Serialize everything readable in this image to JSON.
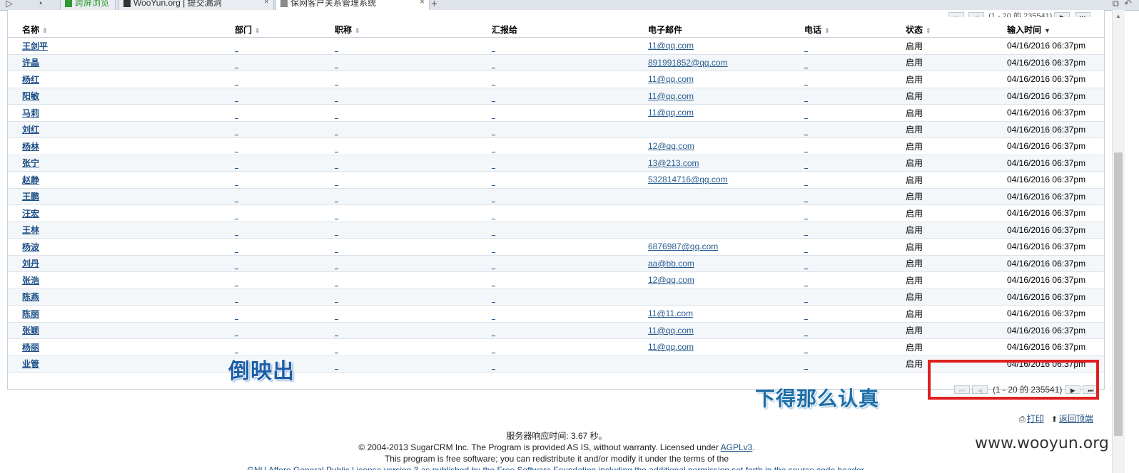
{
  "browser": {
    "tabs": [
      {
        "label": "跨屏浏览"
      },
      {
        "label": "WooYun.org | 提交漏洞"
      },
      {
        "label": "保网客户关系管理系统"
      }
    ],
    "new_tab": "+"
  },
  "columns": [
    {
      "label": "名称",
      "sort": "⇕"
    },
    {
      "label": "部门",
      "sort": "⇕"
    },
    {
      "label": "职称",
      "sort": "⇕"
    },
    {
      "label": "汇报给",
      "sort": ""
    },
    {
      "label": "电子邮件",
      "sort": ""
    },
    {
      "label": "电话",
      "sort": "⇕"
    },
    {
      "label": "状态",
      "sort": "⇕"
    },
    {
      "label": "输入时间",
      "sort": "▼"
    }
  ],
  "rows": [
    {
      "name": "王剑平",
      "email": "11@qq.com",
      "status": "启用",
      "date": "04/16/2016 06:37pm"
    },
    {
      "name": "许晶",
      "email": "891991852@qq.com",
      "status": "启用",
      "date": "04/16/2016 06:37pm"
    },
    {
      "name": "杨红",
      "email": "11@qq.com",
      "status": "启用",
      "date": "04/16/2016 06:37pm"
    },
    {
      "name": "阳敏",
      "email": "11@qq.com",
      "status": "启用",
      "date": "04/16/2016 06:37pm"
    },
    {
      "name": "马莉",
      "email": "11@qq.com",
      "status": "启用",
      "date": "04/16/2016 06:37pm"
    },
    {
      "name": "刘红",
      "email": "",
      "status": "启用",
      "date": "04/16/2016 06:37pm"
    },
    {
      "name": "杨林",
      "email": "12@qq.com",
      "status": "启用",
      "date": "04/16/2016 06:37pm"
    },
    {
      "name": "张宁",
      "email": "13@213.com",
      "status": "启用",
      "date": "04/16/2016 06:37pm"
    },
    {
      "name": "赵静",
      "email": "532814716@qq.com",
      "status": "启用",
      "date": "04/16/2016 06:37pm"
    },
    {
      "name": "王鹏",
      "email": "",
      "status": "启用",
      "date": "04/16/2016 06:37pm"
    },
    {
      "name": "汪宏",
      "email": "",
      "status": "启用",
      "date": "04/16/2016 06:37pm"
    },
    {
      "name": "王林",
      "email": "",
      "status": "启用",
      "date": "04/16/2016 06:37pm"
    },
    {
      "name": "杨波",
      "email": "6876987@qq.com",
      "status": "启用",
      "date": "04/16/2016 06:37pm"
    },
    {
      "name": "刘丹",
      "email": "aa@bb.com",
      "status": "启用",
      "date": "04/16/2016 06:37pm"
    },
    {
      "name": "张浩",
      "email": "12@qq.com",
      "status": "启用",
      "date": "04/16/2016 06:37pm"
    },
    {
      "name": "陈燕",
      "email": "",
      "status": "启用",
      "date": "04/16/2016 06:37pm"
    },
    {
      "name": "陈丽",
      "email": "11@11.com",
      "status": "启用",
      "date": "04/16/2016 06:37pm"
    },
    {
      "name": "张颖",
      "email": "11@qq.com",
      "status": "启用",
      "date": "04/16/2016 06:37pm"
    },
    {
      "name": "杨丽",
      "email": "11@qq.com",
      "status": "启用",
      "date": "04/16/2016 06:37pm"
    },
    {
      "name": "业管",
      "email": "",
      "status": "启用",
      "date": "04/16/2016 06:37pm"
    }
  ],
  "placeholder_dash": "_",
  "pager": {
    "first": "⏮",
    "prev": "◀",
    "next": "▶",
    "last": "⏭",
    "text": "(1 - 20 的 235541)"
  },
  "annotations": {
    "left": "倒映出",
    "right": "下得那么认真"
  },
  "actions": {
    "print": "打印",
    "back_to_top": "返回顶端"
  },
  "footer": {
    "response_time": "服务器响应时间: 3.67 秒。",
    "copyright_prefix": "© 2004-2013 SugarCRM Inc. The Program is provided AS IS, without warranty. Licensed under ",
    "license_link": "AGPLv3",
    "copyright_suffix": ".",
    "free_software": "This program is free software; you can redistribute it and/or modify it under the terms of the",
    "cut_line": "GNU Affero General Public License version 3 as published by the Free Software Foundation including the additional permission set forth in the source code header."
  },
  "watermark": "www.wooyun.org",
  "colors": {
    "link": "#1d4f86",
    "highlight_box": "#e02020",
    "annotation": "#1d5fa8"
  }
}
